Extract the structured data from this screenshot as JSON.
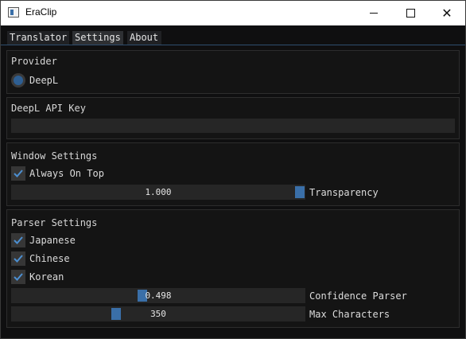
{
  "window": {
    "title": "EraClip"
  },
  "tabs": [
    {
      "label": "Translator"
    },
    {
      "label": "Settings"
    },
    {
      "label": "About"
    }
  ],
  "provider": {
    "title": "Provider",
    "option_label": "DeepL",
    "selected": true
  },
  "api_key": {
    "title": "DeepL API Key",
    "value": ""
  },
  "window_settings": {
    "title": "Window Settings",
    "always_on_top": {
      "label": "Always On Top",
      "checked": true
    },
    "transparency": {
      "label": "Transparency",
      "value": "1.000",
      "fraction": 1.0
    }
  },
  "parser_settings": {
    "title": "Parser Settings",
    "languages": [
      {
        "label": "Japanese",
        "checked": true
      },
      {
        "label": "Chinese",
        "checked": true
      },
      {
        "label": "Korean",
        "checked": true
      }
    ],
    "confidence": {
      "label": "Confidence Parser",
      "value": "0.498",
      "fraction": 0.498
    },
    "max_chars": {
      "label": "Max Characters",
      "value": "350",
      "fraction": 0.35
    }
  },
  "colors": {
    "accent": "#3a6fa8",
    "check": "#4c8fd1",
    "panel": "#141414",
    "frame": "#262626"
  }
}
